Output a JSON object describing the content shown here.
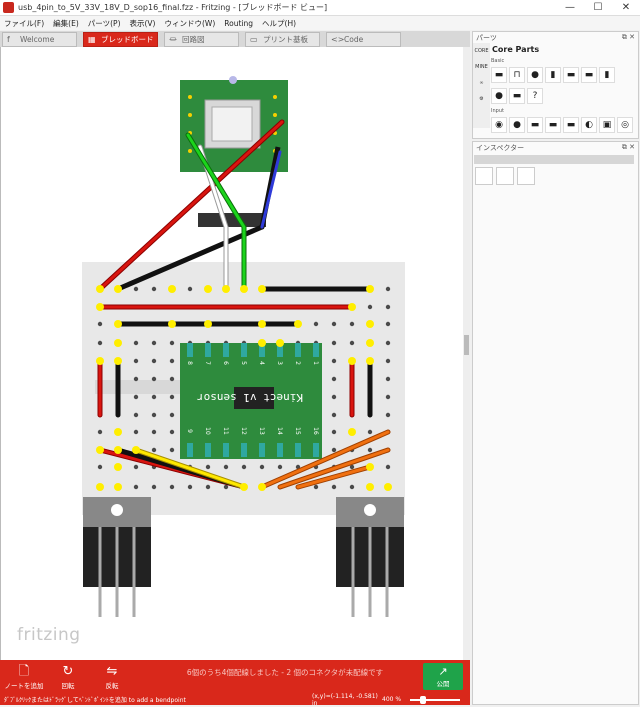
{
  "window": {
    "title": "usb_4pin_to_5V_33V_18V_D_sop16_final.fzz - Fritzing - [ブレッドボード ビュー]",
    "minimize": "—",
    "maximize": "☐",
    "close": "✕"
  },
  "menu": [
    "ファイル(F)",
    "編集(E)",
    "パーツ(P)",
    "表示(V)",
    "ウィンドウ(W)",
    "Routing",
    "ヘルプ(H)"
  ],
  "tabs": [
    {
      "label": "Welcome",
      "icon": "f"
    },
    {
      "label": "ブレッドボード",
      "icon": "▦"
    },
    {
      "label": "回路図",
      "icon": "⏛"
    },
    {
      "label": "プリント基板",
      "icon": "▭"
    },
    {
      "label": "Code",
      "icon": "<>"
    }
  ],
  "canvas": {
    "logo": "fritzing",
    "sensor_label": "Kinect v1 sensor",
    "pin_labels_top": [
      "8",
      "7",
      "6",
      "5",
      "4",
      "3",
      "2",
      "1"
    ],
    "pin_labels_bottom": [
      "9",
      "10",
      "11",
      "12",
      "13",
      "14",
      "15",
      "16"
    ]
  },
  "bottombar": {
    "add_note": "ノートを追加",
    "rotate": "回転",
    "flip": "反転",
    "status": "6個のうち4個配線しました - 2 個のコネクタが未配線です",
    "share": "公開"
  },
  "statusbar": {
    "hint": "ﾀﾞﾌﾞﾙｸﾘｯｸまたはﾄﾞﾗｯｸﾞしてﾍﾞﾝﾄﾞﾎﾟｲﾝﾄを追加 to add a bendpoint",
    "coords": "(x,y)=(-1.114, -0.581) in",
    "zoom": "400 %"
  },
  "parts": {
    "title": "パーツ",
    "bin": "Core Parts",
    "tabs": [
      "CORE",
      "MINE",
      "∞",
      "⚙"
    ],
    "section_basic": "Basic",
    "section_input": "Input",
    "row1": [
      "▬",
      "⊓",
      "●",
      "▮",
      "▬",
      "▬",
      "▮"
    ],
    "row2": [
      "●",
      "▬",
      "?"
    ],
    "row3": [
      "◉",
      "●",
      "▬",
      "▬",
      "▬",
      "◐",
      "▣",
      "◎"
    ]
  },
  "inspector": {
    "title": "インスペクター"
  },
  "colors": {
    "accent": "#d9281b",
    "share": "#1fa34a",
    "pcb": "#2e8b3d",
    "breadboard": "#e6e6e6"
  }
}
